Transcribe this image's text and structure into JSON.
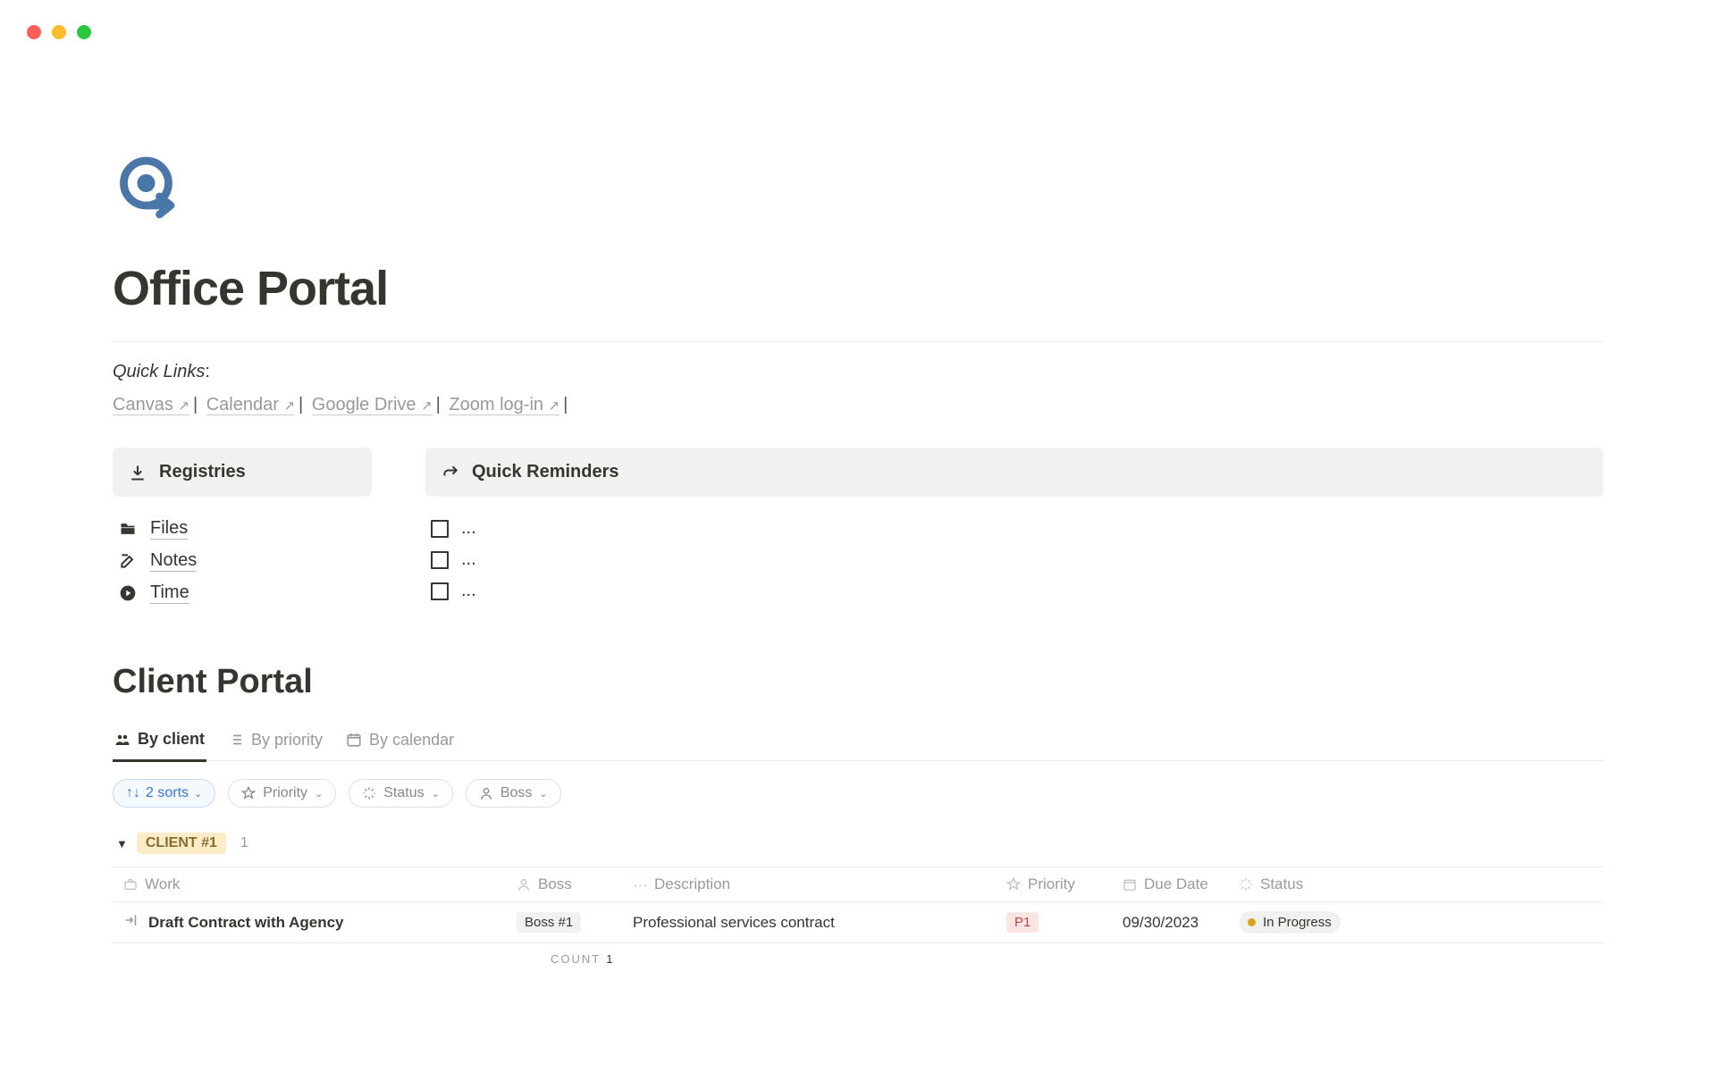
{
  "page": {
    "title": "Office Portal"
  },
  "quick_links": {
    "label": "Quick Links",
    "items": [
      {
        "label": "Canvas"
      },
      {
        "label": "Calendar"
      },
      {
        "label": "Google Drive"
      },
      {
        "label": "Zoom log-in"
      }
    ]
  },
  "registries": {
    "title": "Registries",
    "items": [
      {
        "icon": "folder",
        "label": "Files"
      },
      {
        "icon": "edit",
        "label": "Notes"
      },
      {
        "icon": "play",
        "label": "Time"
      }
    ]
  },
  "reminders": {
    "title": "Quick Reminders",
    "placeholder": "...",
    "count": 3
  },
  "client_portal": {
    "title": "Client Portal",
    "tabs": [
      {
        "icon": "group",
        "label": "By client",
        "active": true
      },
      {
        "icon": "list",
        "label": "By priority",
        "active": false
      },
      {
        "icon": "calendar",
        "label": "By calendar",
        "active": false
      }
    ],
    "sort_label": "2 sorts",
    "filters": [
      {
        "icon": "star",
        "label": "Priority"
      },
      {
        "icon": "spinner",
        "label": "Status"
      },
      {
        "icon": "person",
        "label": "Boss"
      }
    ],
    "group": {
      "name": "CLIENT #1",
      "count": "1"
    },
    "columns": {
      "work": "Work",
      "boss": "Boss",
      "description": "Description",
      "priority": "Priority",
      "due_date": "Due Date",
      "status": "Status"
    },
    "rows": [
      {
        "work": "Draft Contract with Agency",
        "boss": "Boss #1",
        "description": "Professional services contract",
        "priority": "P1",
        "due_date": "09/30/2023",
        "status": "In Progress"
      }
    ],
    "footer": {
      "count_label": "COUNT",
      "count_value": "1"
    }
  }
}
